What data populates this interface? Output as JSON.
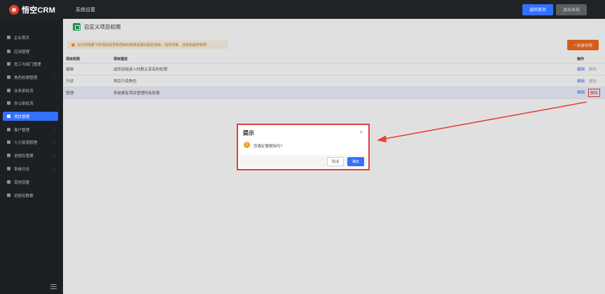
{
  "header": {
    "logo_text": "悟空CRM",
    "nav_label": "系统设置",
    "home_button": "返回首页",
    "logout_button": "退出系统"
  },
  "sidebar": {
    "items": [
      {
        "label": "企业首页",
        "icon": "home-icon"
      },
      {
        "label": "应用管理",
        "icon": "grid-icon"
      },
      {
        "label": "员工与部门管理",
        "icon": "users-icon"
      },
      {
        "label": "角色权限管理",
        "icon": "user-role-icon"
      },
      {
        "label": "业务审批流",
        "icon": "approval-icon"
      },
      {
        "label": "办公审批流",
        "icon": "approval-icon"
      },
      {
        "label": "项目管理",
        "icon": "project-icon"
      },
      {
        "label": "客户管理",
        "icon": "customer-icon"
      },
      {
        "label": "人力资源管理",
        "icon": "hr-icon"
      },
      {
        "label": "进销存管理",
        "icon": "inventory-icon"
      },
      {
        "label": "系统日志",
        "icon": "log-icon"
      },
      {
        "label": "其他设置",
        "icon": "gear-icon"
      },
      {
        "label": "初始化数据",
        "icon": "chart-icon"
      }
    ],
    "active_index": 6
  },
  "page": {
    "title": "自定义项目权限",
    "tip": "为不同场景下的项目成员和项目的权限设置匹配的项目、任务列表、任务的操作权限",
    "new_button": "新建权限"
  },
  "table": {
    "headers": {
      "name": "项目权限",
      "desc": "项目描述",
      "ops": "操作"
    },
    "rows": [
      {
        "name": "编辑",
        "desc": "成员初始加入时默认享有的权限",
        "edit": "编辑",
        "delete": "删除"
      },
      {
        "name": "只读",
        "desc": "项目只读角色",
        "edit": "编辑",
        "delete": "删除"
      },
      {
        "name": "管理",
        "desc": "系统拥有项目管理所有权限",
        "edit": "编辑",
        "delete": "删除"
      }
    ]
  },
  "dialog": {
    "title": "提示",
    "close": "×",
    "message": "您确定要删除吗?",
    "cancel": "取消",
    "confirm": "确定"
  },
  "colors": {
    "accent": "#3370ff",
    "orange": "#f06c1e",
    "highlight": "#e04040",
    "sidebar_bg": "#1c2024"
  }
}
